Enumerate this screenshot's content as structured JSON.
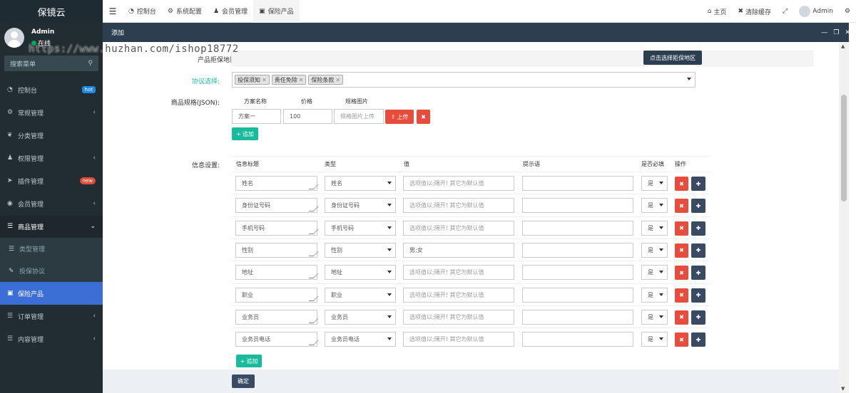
{
  "sidebar": {
    "logo": "保镜云",
    "user": {
      "name": "Admin",
      "status": "在线"
    },
    "search_placeholder": "搜索菜单",
    "items": [
      {
        "label": "控制台",
        "icon": "dashboard-icon",
        "badge": "hot"
      },
      {
        "label": "常规管理",
        "icon": "cogs-icon"
      },
      {
        "label": "分类管理",
        "icon": "leaf-icon"
      },
      {
        "label": "权限管理",
        "icon": "users-icon"
      },
      {
        "label": "插件管理",
        "icon": "rocket-icon",
        "badge": "new"
      },
      {
        "label": "会员管理",
        "icon": "user-circle-icon"
      },
      {
        "label": "商品管理",
        "icon": "list-icon"
      },
      {
        "label": "类型管理",
        "icon": "list-icon"
      },
      {
        "label": "投保协议",
        "icon": "edit-icon"
      },
      {
        "label": "保险产品",
        "icon": "shopping-bag-icon"
      },
      {
        "label": "订单管理",
        "icon": "list-icon"
      },
      {
        "label": "内容管理",
        "icon": "list-icon"
      }
    ]
  },
  "topbar": {
    "tabs": [
      {
        "label": "控制台",
        "icon": "dashboard-icon"
      },
      {
        "label": "系统配置",
        "icon": "gear-icon"
      },
      {
        "label": "会员管理",
        "icon": "user-icon"
      },
      {
        "label": "保险产品",
        "icon": "shopping-bag-icon"
      }
    ],
    "home": "主页",
    "clear_cache": "清除缓存",
    "admin": "Admin"
  },
  "watermark": "https://www.huzhan.com/ishop18772",
  "modal": {
    "title": "添加",
    "region_label": "产品拒保地区:",
    "region_button": "点击选择拒保地区",
    "protocol_label": "协议选择:",
    "protocol_tags": [
      "投保须知",
      "责任免除",
      "保险条款"
    ],
    "spec_label": "商品规格(JSON):",
    "spec_headers": [
      "方案名称",
      "价格",
      "规格图片"
    ],
    "spec_row": {
      "name": "方案一",
      "price": "100",
      "image_placeholder": "规格图片上传",
      "upload": "上传"
    },
    "add_button": "追加",
    "info_label": "信息设置:",
    "info_headers": [
      "信息标题",
      "类型",
      "值",
      "提示语",
      "是否必填",
      "操作"
    ],
    "info_rows": [
      {
        "title": "姓名",
        "type": "姓名",
        "value": "",
        "value_placeholder": "选项值以;隔开! 其它为默认值",
        "required": "是"
      },
      {
        "title": "身份证号码",
        "type": "身份证号码",
        "value": "",
        "value_placeholder": "选项值以;隔开! 其它为默认值",
        "required": "是"
      },
      {
        "title": "手机号码",
        "type": "手机号码",
        "value": "",
        "value_placeholder": "选项值以;隔开! 其它为默认值",
        "required": "是"
      },
      {
        "title": "性别",
        "type": "性别",
        "value": "男;女",
        "value_placeholder": "",
        "required": "是"
      },
      {
        "title": "地址",
        "type": "地址",
        "value": "",
        "value_placeholder": "选项值以;隔开! 其它为默认值",
        "required": "是"
      },
      {
        "title": "职业",
        "type": "职业",
        "value": "",
        "value_placeholder": "选项值以;隔开! 其它为默认值",
        "required": "是"
      },
      {
        "title": "业务员",
        "type": "业务员",
        "value": "",
        "value_placeholder": "选项值以;隔开! 其它为默认值",
        "required": "是"
      },
      {
        "title": "业务员电话",
        "type": "业务员电话",
        "value": "",
        "value_placeholder": "选项值以;隔开! 其它为默认值",
        "required": "是"
      }
    ],
    "info_add_button": "追加",
    "confirm": "确定"
  },
  "colors": {
    "sidebar_bg": "#222d32",
    "active": "#3c6fd6",
    "modal_header": "#2c3e50",
    "danger": "#e74c3c",
    "success": "#18bc9c"
  }
}
